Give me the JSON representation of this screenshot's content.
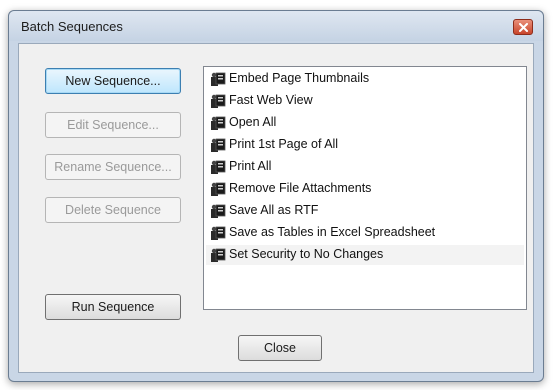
{
  "window": {
    "title": "Batch Sequences",
    "close_icon": "close-icon"
  },
  "buttons": {
    "new_sequence": "New Sequence...",
    "edit_sequence": "Edit Sequence...",
    "rename_sequence": "Rename Sequence...",
    "delete_sequence": "Delete Sequence",
    "run_sequence": "Run Sequence",
    "close": "Close"
  },
  "sequences": [
    "Embed Page Thumbnails",
    "Fast Web View",
    "Open All",
    "Print 1st Page of All",
    "Print All",
    "Remove File Attachments",
    "Save All as RTF",
    "Save as Tables in Excel Spreadsheet",
    "Set Security to No Changes"
  ],
  "item_icon": "batch-sequence-icon",
  "colors": {
    "close_button": "#c8452b",
    "default_button_border": "#3c7fb1",
    "disabled_text": "#9a9a9a"
  }
}
